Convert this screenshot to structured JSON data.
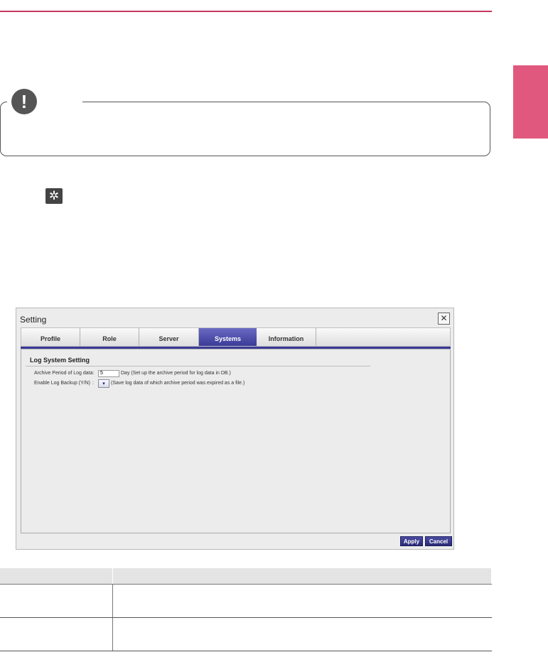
{
  "page": {
    "accent_color": "#c4365e",
    "tab_color": "#e0587e"
  },
  "note": {
    "icon": "exclamation-icon",
    "symbol": "!"
  },
  "gear": {
    "icon": "gear-icon",
    "symbol": "✲"
  },
  "dialog": {
    "title": "Setting",
    "close_symbol": "✕",
    "tabs": [
      {
        "label": "Profile",
        "active": false
      },
      {
        "label": "Role",
        "active": false
      },
      {
        "label": "Server",
        "active": false
      },
      {
        "label": "Systems",
        "active": true
      },
      {
        "label": "Information",
        "active": false
      }
    ],
    "section_title": "Log System Setting",
    "archive": {
      "label": "Archive Period of Log data:",
      "value": "5",
      "suffix": "Day (Set up the archive period for log data in DB.)"
    },
    "backup": {
      "label": "Enable Log Backup (Y/N)",
      "separator": ":",
      "select_symbol": "▾",
      "suffix": "(Save log data of which archive period was expired as a file.)"
    },
    "apply_label": "Apply",
    "cancel_label": "Cancel"
  }
}
